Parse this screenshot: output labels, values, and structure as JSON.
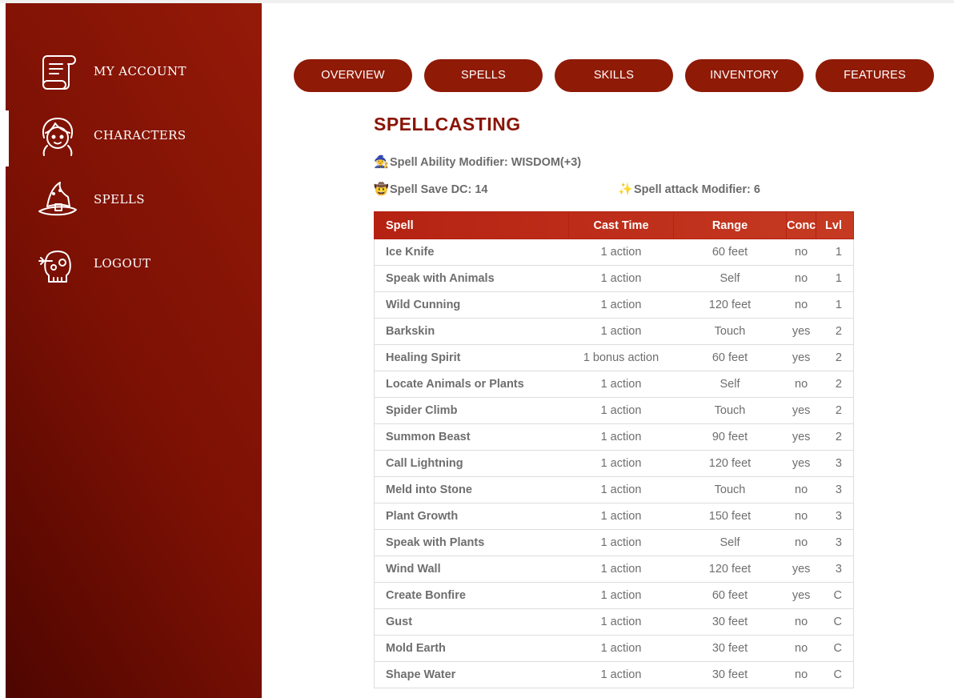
{
  "sidebar": {
    "items": [
      {
        "label": "My Account",
        "icon": "scroll-icon",
        "active": false
      },
      {
        "label": "Characters",
        "icon": "character-icon",
        "active": true
      },
      {
        "label": "Spells",
        "icon": "wizard-hat-icon",
        "active": false
      },
      {
        "label": "Logout",
        "icon": "skull-icon",
        "active": false
      }
    ]
  },
  "tabs": [
    "OVERVIEW",
    "SPELLS",
    "SKILLS",
    "INVENTORY",
    "FEATURES"
  ],
  "main": {
    "title": "SPELLCASTING",
    "ability": {
      "emoji": "🧙",
      "text": "Spell Ability Modifier: WISDOM(+3)"
    },
    "save_dc": {
      "emoji": "🤠",
      "text": "Spell Save DC: 14"
    },
    "attack": {
      "emoji": "✨",
      "text": "Spell attack Modifier: 6"
    }
  },
  "table": {
    "headers": [
      "Spell",
      "Cast Time",
      "Range",
      "Conc",
      "Lvl"
    ],
    "rows": [
      [
        "Ice Knife",
        "1 action",
        "60 feet",
        "no",
        "1"
      ],
      [
        "Speak with Animals",
        "1 action",
        "Self",
        "no",
        "1"
      ],
      [
        "Wild Cunning",
        "1 action",
        "120 feet",
        "no",
        "1"
      ],
      [
        "Barkskin",
        "1 action",
        "Touch",
        "yes",
        "2"
      ],
      [
        "Healing Spirit",
        "1 bonus action",
        "60 feet",
        "yes",
        "2"
      ],
      [
        "Locate Animals or Plants",
        "1 action",
        "Self",
        "no",
        "2"
      ],
      [
        "Spider Climb",
        "1 action",
        "Touch",
        "yes",
        "2"
      ],
      [
        "Summon Beast",
        "1 action",
        "90 feet",
        "yes",
        "2"
      ],
      [
        "Call Lightning",
        "1 action",
        "120 feet",
        "yes",
        "3"
      ],
      [
        "Meld into Stone",
        "1 action",
        "Touch",
        "no",
        "3"
      ],
      [
        "Plant Growth",
        "1 action",
        "150 feet",
        "no",
        "3"
      ],
      [
        "Speak with Plants",
        "1 action",
        "Self",
        "no",
        "3"
      ],
      [
        "Wind Wall",
        "1 action",
        "120 feet",
        "yes",
        "3"
      ],
      [
        "Create Bonfire",
        "1 action",
        "60 feet",
        "yes",
        "C"
      ],
      [
        "Gust",
        "1 action",
        "30 feet",
        "no",
        "C"
      ],
      [
        "Mold Earth",
        "1 action",
        "30 feet",
        "no",
        "C"
      ],
      [
        "Shape Water",
        "1 action",
        "30 feet",
        "no",
        "C"
      ]
    ]
  },
  "colors": {
    "sidebar_dark": "#4e0600",
    "sidebar_light": "#951a08",
    "tab_bg": "#8f1a06",
    "title": "#8a1405",
    "table_header": "#b52212"
  }
}
